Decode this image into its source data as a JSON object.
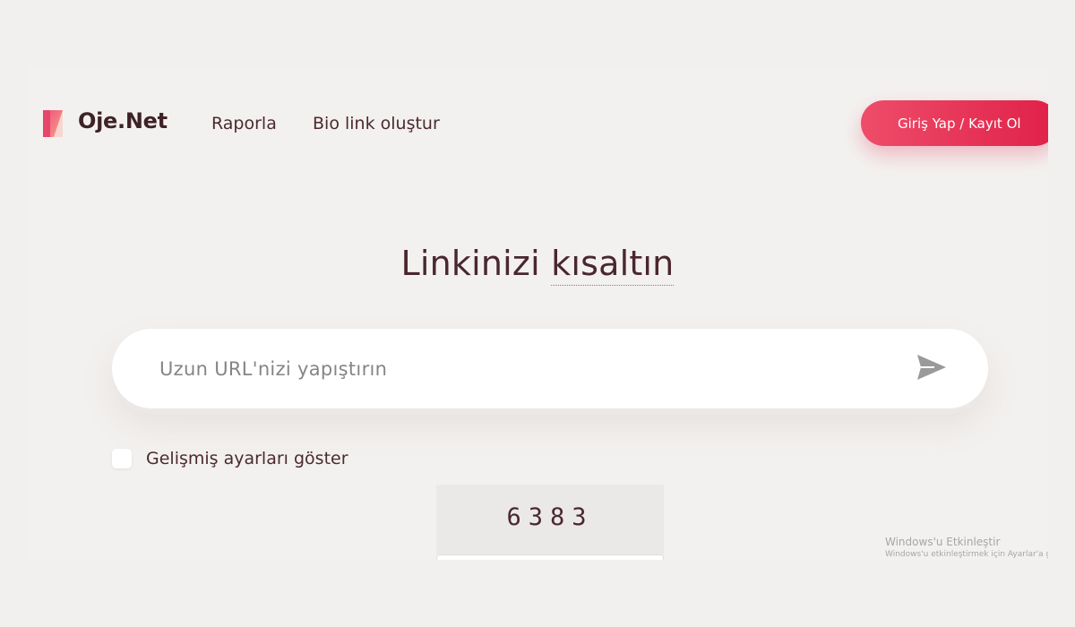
{
  "header": {
    "logo_text": "Oje.Net",
    "nav": [
      {
        "label": "Raporla"
      },
      {
        "label": "Bio link oluştur"
      }
    ],
    "login_label": "Giriş Yap / Kayıt Ol"
  },
  "hero": {
    "title_part1": "Linkinizi ",
    "title_part2": "kısaltın"
  },
  "shorten": {
    "placeholder": "Uzun URL'nizi yapıştırın",
    "value": ""
  },
  "advanced": {
    "label": "Gelişmiş ayarları göster",
    "checked": false
  },
  "captcha": {
    "code": "6383"
  },
  "watermark": {
    "line1": "Windows'u Etkinleştir",
    "line2": "Windows'u etkinleştirmek için Ayarlar'a gid"
  },
  "colors": {
    "accent": "#e02048",
    "accent_light": "#ee4d6a",
    "text": "#4a2a30",
    "background": "#f3f1ef"
  },
  "icons": {
    "logo": "oje-logo-icon",
    "send": "send-arrow-icon"
  }
}
